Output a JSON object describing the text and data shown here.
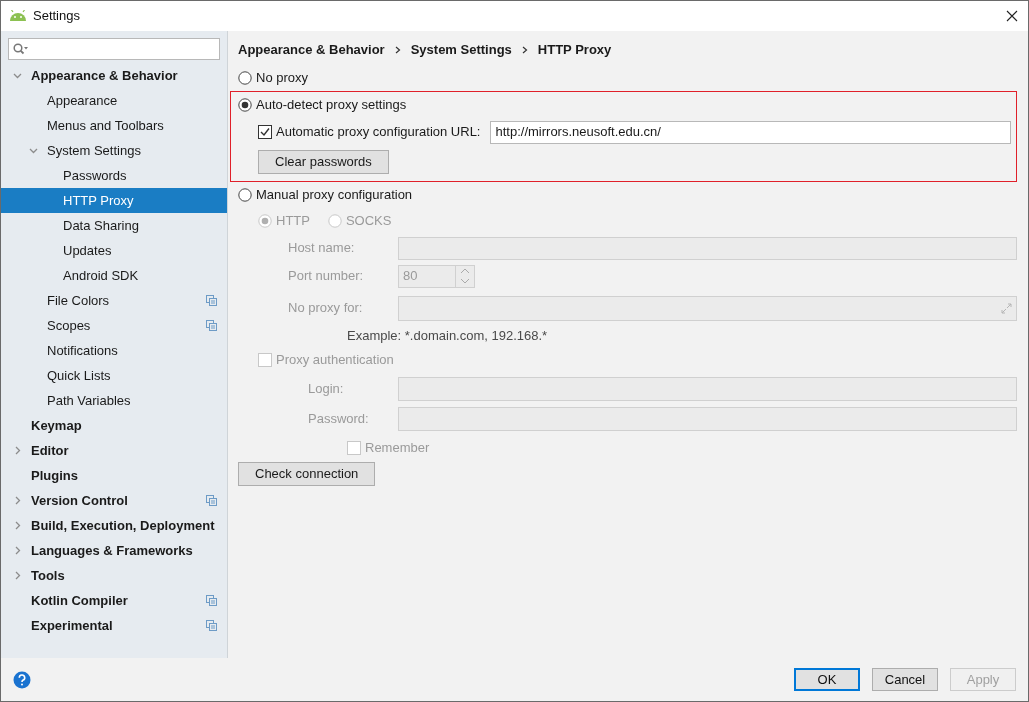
{
  "window": {
    "title": "Settings"
  },
  "sidebar": {
    "tree": [
      {
        "label": "Appearance & Behavior",
        "bold": true,
        "expanded": true,
        "selected": false,
        "children": [
          {
            "label": "Appearance",
            "selected": false
          },
          {
            "label": "Menus and Toolbars",
            "selected": false
          },
          {
            "label": "System Settings",
            "expanded": true,
            "selected": false,
            "children": [
              {
                "label": "Passwords",
                "selected": false
              },
              {
                "label": "HTTP Proxy",
                "selected": true
              },
              {
                "label": "Data Sharing",
                "selected": false
              },
              {
                "label": "Updates",
                "selected": false
              },
              {
                "label": "Android SDK",
                "selected": false
              }
            ]
          },
          {
            "label": "File Colors",
            "scoped": true,
            "selected": false
          },
          {
            "label": "Scopes",
            "scoped": true,
            "selected": false
          },
          {
            "label": "Notifications",
            "selected": false
          },
          {
            "label": "Quick Lists",
            "selected": false
          },
          {
            "label": "Path Variables",
            "selected": false
          }
        ]
      },
      {
        "label": "Keymap",
        "bold": true,
        "selected": false
      },
      {
        "label": "Editor",
        "bold": true,
        "expanded": false,
        "selected": false
      },
      {
        "label": "Plugins",
        "bold": true,
        "selected": false
      },
      {
        "label": "Version Control",
        "bold": true,
        "expanded": false,
        "scoped": true,
        "selected": false
      },
      {
        "label": "Build, Execution, Deployment",
        "bold": true,
        "expanded": false,
        "selected": false
      },
      {
        "label": "Languages & Frameworks",
        "bold": true,
        "expanded": false,
        "selected": false
      },
      {
        "label": "Tools",
        "bold": true,
        "expanded": false,
        "selected": false
      },
      {
        "label": "Kotlin Compiler",
        "bold": true,
        "scoped": true,
        "selected": false
      },
      {
        "label": "Experimental",
        "bold": true,
        "scoped": true,
        "selected": false
      }
    ]
  },
  "breadcrumb": [
    "Appearance & Behavior",
    "System Settings",
    "HTTP Proxy"
  ],
  "proxy_modes": [
    {
      "label": "No proxy",
      "selected": false
    },
    {
      "label": "Auto-detect proxy settings",
      "selected": true
    },
    {
      "label": "Manual proxy configuration",
      "selected": false
    }
  ],
  "auto_detect": {
    "highlighted": true,
    "config_url": {
      "label": "Automatic proxy configuration URL:",
      "checked": true,
      "value": "http://mirrors.neusoft.edu.cn/"
    },
    "clear_button": "Clear passwords"
  },
  "manual": {
    "disabled": true,
    "protocols": [
      {
        "label": "HTTP",
        "selected": true
      },
      {
        "label": "SOCKS",
        "selected": false
      }
    ],
    "host_name": {
      "label": "Host name:"
    },
    "port_number": {
      "label": "Port number:",
      "value": "80"
    },
    "no_proxy_for": {
      "label": "No proxy for:",
      "hint": "Example: *.domain.com, 192.168.*"
    },
    "proxy_authentication": {
      "label": "Proxy authentication",
      "checked": false
    },
    "login": {
      "label": "Login:"
    },
    "password": {
      "label": "Password:"
    },
    "remember": {
      "label": "Remember",
      "checked": false
    }
  },
  "check_button": "Check connection",
  "footer": {
    "buttons": [
      {
        "label": "OK",
        "kind": "default",
        "disabled": false
      },
      {
        "label": "Cancel",
        "kind": "normal",
        "disabled": false
      },
      {
        "label": "Apply",
        "kind": "normal",
        "disabled": true
      }
    ]
  }
}
